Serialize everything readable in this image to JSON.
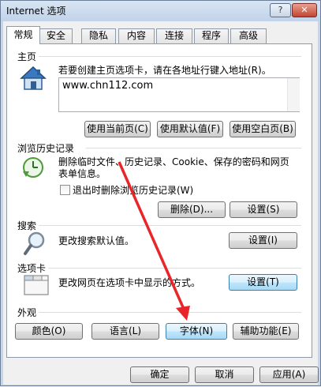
{
  "window": {
    "title": "Internet 选项",
    "help_label": "?",
    "close_label": "✕"
  },
  "tabs": [
    {
      "label": "常规",
      "active": true
    },
    {
      "label": "安全"
    },
    {
      "label": "隐私"
    },
    {
      "label": "内容"
    },
    {
      "label": "连接"
    },
    {
      "label": "程序"
    },
    {
      "label": "高级"
    }
  ],
  "homepage": {
    "group_label": "主页",
    "icon": "home-icon",
    "description": "若要创建主页选项卡，请在各地址行键入地址(R)。",
    "url": "www.chn112.com",
    "use_current_label": "使用当前页(C)",
    "use_default_label": "使用默认值(F)",
    "use_blank_label": "使用空白页(B)"
  },
  "history": {
    "group_label": "浏览历史记录",
    "icon": "history-clock-icon",
    "description": "删除临时文件、历史记录、Cookie、保存的密码和网页表单信息。",
    "delete_on_exit_label": "退出时删除浏览历史记录(W)",
    "delete_on_exit_checked": false,
    "delete_label": "删除(D)...",
    "settings_label": "设置(S)"
  },
  "search": {
    "group_label": "搜索",
    "icon": "magnifier-icon",
    "description": "更改搜索默认值。",
    "settings_label": "设置(I)"
  },
  "tabs_group": {
    "group_label": "选项卡",
    "icon": "tabs-window-icon",
    "description": "更改网页在选项卡中显示的方式。",
    "settings_label": "设置(T)"
  },
  "appearance": {
    "group_label": "外观",
    "colors_label": "颜色(O)",
    "languages_label": "语言(L)",
    "fonts_label": "字体(N)",
    "accessibility_label": "辅助功能(E)"
  },
  "footer": {
    "ok_label": "确定",
    "cancel_label": "取消",
    "apply_label": "应用(A)"
  },
  "colors": {
    "annotation_arrow": "#e8262a",
    "focus_border": "#3c7fb1"
  }
}
